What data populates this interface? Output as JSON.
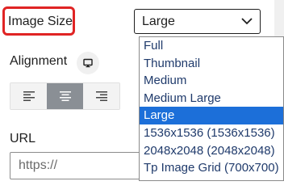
{
  "image_size": {
    "label": "Image Size",
    "selected": "Large",
    "options": [
      "Full",
      "Thumbnail",
      "Medium",
      "Medium Large",
      "Large",
      "1536x1536 (1536x1536)",
      "2048x2048 (2048x2048)",
      "Tp Image Grid (700x700)"
    ]
  },
  "alignment": {
    "label": "Alignment",
    "device_icon": "desktop-icon",
    "buttons": [
      {
        "icon": "align-left-icon",
        "active": false
      },
      {
        "icon": "align-center-icon",
        "active": true
      },
      {
        "icon": "align-right-icon",
        "active": false
      }
    ]
  },
  "url": {
    "label": "URL",
    "placeholder": "https://"
  },
  "colors": {
    "highlight_border": "#e02424",
    "selected_option": "#1c6fd9",
    "active_align": "#8a8f95"
  }
}
